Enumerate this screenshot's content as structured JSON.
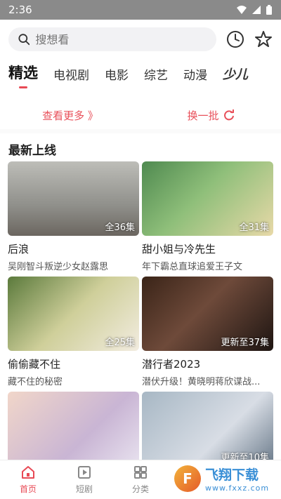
{
  "status": {
    "time": "2:36"
  },
  "search": {
    "placeholder": "搜想看"
  },
  "tabs": [
    {
      "label": "精选",
      "active": true
    },
    {
      "label": "电视剧"
    },
    {
      "label": "电影"
    },
    {
      "label": "综艺"
    },
    {
      "label": "动漫"
    },
    {
      "label": "少儿"
    }
  ],
  "actions": {
    "more": "查看更多 》",
    "refresh": "换一批"
  },
  "section": {
    "title": "最新上线"
  },
  "cards": [
    {
      "title": "后浪",
      "desc": "吴刚智斗叛逆少女赵露思",
      "badge": "全36集"
    },
    {
      "title": "甜小姐与冷先生",
      "desc": "年下霸总直球追爱王子文",
      "badge": "全31集"
    },
    {
      "title": "偷偷藏不住",
      "desc": "藏不住的秘密",
      "badge": "全25集"
    },
    {
      "title": "潜行者2023",
      "desc": "潜伏升级！黄晓明蒋欣谍战...",
      "badge": "更新至37集"
    },
    {
      "title": "",
      "desc": "",
      "badge": ""
    },
    {
      "title": "",
      "desc": "",
      "badge": "更新至10集"
    }
  ],
  "nav": [
    {
      "label": "首页",
      "active": true
    },
    {
      "label": "短剧"
    },
    {
      "label": "分类"
    }
  ],
  "watermark": {
    "main": "飞翔下载",
    "sub": "www.fxxz.com"
  },
  "colors": {
    "accent": "#e84a55",
    "link": "#e8505a"
  }
}
